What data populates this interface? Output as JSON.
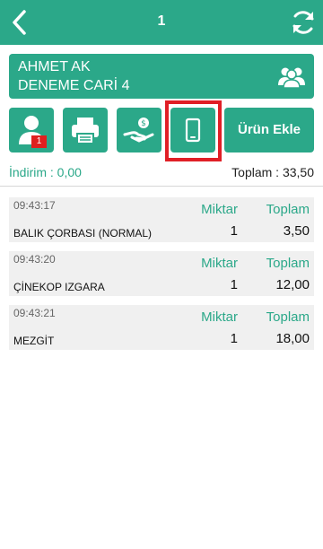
{
  "header": {
    "title": "1",
    "back_icon": "chevron-left-icon",
    "refresh_icon": "refresh-icon"
  },
  "customer": {
    "name": "AHMET AK",
    "account": "DENEME CARİ 4",
    "icon": "users-group-icon"
  },
  "toolbar": {
    "user_badge": "1",
    "add_product_label": "Ürün Ekle",
    "icons": [
      "user-icon",
      "printer-icon",
      "cash-hand-icon",
      "mobile-phone-icon"
    ]
  },
  "summary": {
    "discount": "İndirim : 0,00",
    "total": "Toplam : 33,50"
  },
  "labels": {
    "quantity": "Miktar",
    "total": "Toplam"
  },
  "items": [
    {
      "time": "09:43:17",
      "name": "BALIK ÇORBASI (NORMAL)",
      "quantity": "1",
      "total": "3,50"
    },
    {
      "time": "09:43:20",
      "name": "ÇİNEKOP IZGARA",
      "quantity": "1",
      "total": "12,00"
    },
    {
      "time": "09:43:21",
      "name": "MEZGİT",
      "quantity": "1",
      "total": "18,00"
    }
  ],
  "colors": {
    "primary": "#2ba889",
    "highlight": "#e01f26",
    "badge": "#e0201f",
    "row_bg": "#f0f0f0"
  }
}
